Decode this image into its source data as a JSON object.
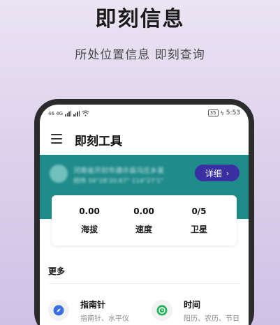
{
  "promo": {
    "title": "即刻信息",
    "subtitle": "所处位置信息 即刻查询"
  },
  "status_bar": {
    "left_indicators": "46 4G",
    "battery": "35",
    "time": "5:53"
  },
  "app_bar": {
    "title": "即刻工具"
  },
  "banner": {
    "location_line1": "河南省开封市通许县冯庄乡某",
    "location_line2": "经纬 34°28'20.67\" 114°27'1\"",
    "detail_button": "详细"
  },
  "stats": [
    {
      "value": "0.00",
      "label": "海拔"
    },
    {
      "value": "0.00",
      "label": "速度"
    },
    {
      "value": "0/5",
      "label": "卫星"
    }
  ],
  "more": {
    "label": "更多",
    "tools": [
      {
        "name": "指南针",
        "desc": "指南针、水平仪",
        "icon": "compass-icon",
        "color": "#3a6fe0"
      },
      {
        "name": "时间",
        "desc": "阳历、农历、节日",
        "icon": "clock-icon",
        "color": "#22b35a"
      }
    ]
  }
}
